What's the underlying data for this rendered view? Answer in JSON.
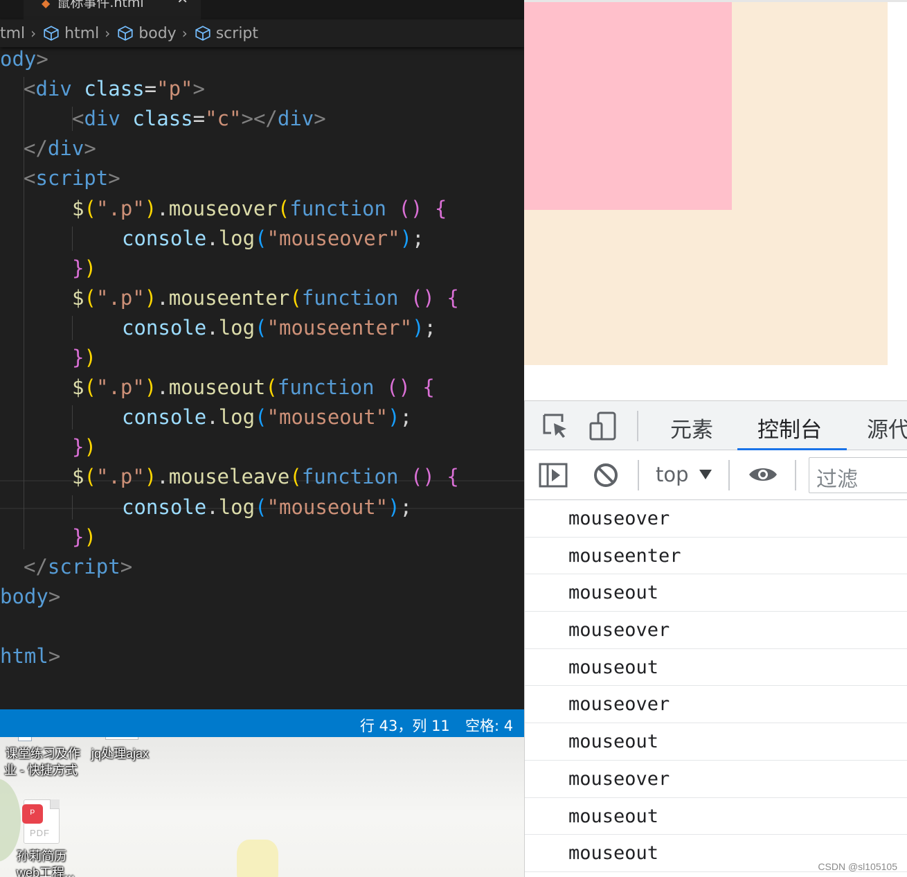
{
  "editor": {
    "tab": {
      "filename": "鼠标事件.html",
      "close_glyph": "✕"
    },
    "breadcrumb": {
      "items": [
        "tml",
        "html",
        "body",
        "script"
      ],
      "separator": "›"
    },
    "code_lines": [
      {
        "indent": 0,
        "tokens": [
          [
            "t-tag",
            "ody"
          ],
          [
            "t-punct",
            ">"
          ]
        ]
      },
      {
        "indent": 1,
        "tokens": [
          [
            "t-punct",
            "<"
          ],
          [
            "t-tag",
            "div"
          ],
          [
            "t-white",
            " "
          ],
          [
            "t-attr",
            "class"
          ],
          [
            "t-white",
            "="
          ],
          [
            "t-str",
            "\"p\""
          ],
          [
            "t-punct",
            ">"
          ]
        ]
      },
      {
        "indent": 2,
        "tokens": [
          [
            "t-punct",
            "<"
          ],
          [
            "t-tag",
            "div"
          ],
          [
            "t-white",
            " "
          ],
          [
            "t-attr",
            "class"
          ],
          [
            "t-white",
            "="
          ],
          [
            "t-str",
            "\"c\""
          ],
          [
            "t-punct",
            "></"
          ],
          [
            "t-tag",
            "div"
          ],
          [
            "t-punct",
            ">"
          ]
        ]
      },
      {
        "indent": 1,
        "tokens": [
          [
            "t-punct",
            "</"
          ],
          [
            "t-tag",
            "div"
          ],
          [
            "t-punct",
            ">"
          ]
        ]
      },
      {
        "indent": 1,
        "tokens": [
          [
            "t-punct",
            "<"
          ],
          [
            "t-tag",
            "script"
          ],
          [
            "t-punct",
            ">"
          ]
        ]
      },
      {
        "indent": 2,
        "tokens": [
          [
            "t-fn",
            "$"
          ],
          [
            "b1",
            "("
          ],
          [
            "t-str",
            "\".p\""
          ],
          [
            "b1",
            ")"
          ],
          [
            "t-white",
            "."
          ],
          [
            "t-fn",
            "mouseover"
          ],
          [
            "b1",
            "("
          ],
          [
            "t-kw",
            "function"
          ],
          [
            "t-white",
            " "
          ],
          [
            "b2",
            "()"
          ],
          [
            "t-white",
            " "
          ],
          [
            "b2",
            "{"
          ]
        ]
      },
      {
        "indent": 3,
        "tokens": [
          [
            "t-attr",
            "console"
          ],
          [
            "t-white",
            "."
          ],
          [
            "t-fn",
            "log"
          ],
          [
            "b3",
            "("
          ],
          [
            "t-str",
            "\"mouseover\""
          ],
          [
            "b3",
            ")"
          ],
          [
            "t-white",
            ";"
          ]
        ]
      },
      {
        "indent": 2,
        "tokens": [
          [
            "b2",
            "}"
          ],
          [
            "b1",
            ")"
          ]
        ]
      },
      {
        "indent": 2,
        "tokens": [
          [
            "t-fn",
            "$"
          ],
          [
            "b1",
            "("
          ],
          [
            "t-str",
            "\".p\""
          ],
          [
            "b1",
            ")"
          ],
          [
            "t-white",
            "."
          ],
          [
            "t-fn",
            "mouseenter"
          ],
          [
            "b1",
            "("
          ],
          [
            "t-kw",
            "function"
          ],
          [
            "t-white",
            " "
          ],
          [
            "b2",
            "()"
          ],
          [
            "t-white",
            " "
          ],
          [
            "b2",
            "{"
          ]
        ]
      },
      {
        "indent": 3,
        "tokens": [
          [
            "t-attr",
            "console"
          ],
          [
            "t-white",
            "."
          ],
          [
            "t-fn",
            "log"
          ],
          [
            "b3",
            "("
          ],
          [
            "t-str",
            "\"mouseenter\""
          ],
          [
            "b3",
            ")"
          ],
          [
            "t-white",
            ";"
          ]
        ]
      },
      {
        "indent": 2,
        "tokens": [
          [
            "b2",
            "}"
          ],
          [
            "b1",
            ")"
          ]
        ]
      },
      {
        "indent": 2,
        "tokens": [
          [
            "t-fn",
            "$"
          ],
          [
            "b1",
            "("
          ],
          [
            "t-str",
            "\".p\""
          ],
          [
            "b1",
            ")"
          ],
          [
            "t-white",
            "."
          ],
          [
            "t-fn",
            "mouseout"
          ],
          [
            "b1",
            "("
          ],
          [
            "t-kw",
            "function"
          ],
          [
            "t-white",
            " "
          ],
          [
            "b2",
            "()"
          ],
          [
            "t-white",
            " "
          ],
          [
            "b2",
            "{"
          ]
        ]
      },
      {
        "indent": 3,
        "tokens": [
          [
            "t-attr",
            "console"
          ],
          [
            "t-white",
            "."
          ],
          [
            "t-fn",
            "log"
          ],
          [
            "b3",
            "("
          ],
          [
            "t-str",
            "\"mouseout\""
          ],
          [
            "b3",
            ")"
          ],
          [
            "t-white",
            ";"
          ]
        ]
      },
      {
        "indent": 2,
        "tokens": [
          [
            "b2",
            "}"
          ],
          [
            "b1",
            ")"
          ]
        ]
      },
      {
        "indent": 2,
        "tokens": [
          [
            "t-fn",
            "$"
          ],
          [
            "b1",
            "("
          ],
          [
            "t-str",
            "\".p\""
          ],
          [
            "b1",
            ")"
          ],
          [
            "t-white",
            "."
          ],
          [
            "t-fn",
            "mouseleave"
          ],
          [
            "b1",
            "("
          ],
          [
            "t-kw",
            "function"
          ],
          [
            "t-white",
            " "
          ],
          [
            "b2",
            "()"
          ],
          [
            "t-white",
            " "
          ],
          [
            "b2",
            "{"
          ]
        ]
      },
      {
        "indent": 3,
        "tokens": [
          [
            "t-attr",
            "console"
          ],
          [
            "t-white",
            "."
          ],
          [
            "t-fn",
            "log"
          ],
          [
            "b3",
            "("
          ],
          [
            "t-str",
            "\"mouseout\""
          ],
          [
            "b3",
            ")"
          ],
          [
            "t-white",
            ";"
          ]
        ]
      },
      {
        "indent": 2,
        "tokens": [
          [
            "b2",
            "}"
          ],
          [
            "b1",
            ")"
          ]
        ]
      },
      {
        "indent": 1,
        "tokens": [
          [
            "t-punct",
            "</"
          ],
          [
            "t-tag",
            "script"
          ],
          [
            "t-punct",
            ">"
          ]
        ]
      },
      {
        "indent": 0,
        "tokens": [
          [
            "t-tag",
            "body"
          ],
          [
            "t-punct",
            ">"
          ]
        ]
      },
      {
        "indent": 0,
        "tokens": []
      },
      {
        "indent": 0,
        "tokens": [
          [
            "t-tag",
            "html"
          ],
          [
            "t-punct",
            ">"
          ]
        ]
      }
    ],
    "status": {
      "position": "行 43，列 11",
      "spaces": "空格: 4"
    }
  },
  "desktop": {
    "icons": [
      {
        "label_line1": "课堂练习及作",
        "label_line2": "业 - 快捷方式"
      },
      {
        "label_line1": "jq处理ajax",
        "label_line2": ""
      },
      {
        "label_line1": "孙莉简历",
        "label_line2": "web工程...",
        "file_type": "PDF"
      }
    ]
  },
  "page": {
    "outer_box_color": "#faebd7",
    "inner_box_color": "#ffc0cb"
  },
  "devtools": {
    "tabs": [
      "元素",
      "控制台",
      "源代"
    ],
    "active_tab": "控制台",
    "context": "top",
    "filter_placeholder": "过滤",
    "console_messages": [
      "mouseover",
      "mouseenter",
      "mouseout",
      "mouseover",
      "mouseout",
      "mouseover",
      "mouseout",
      "mouseover",
      "mouseout",
      "mouseout"
    ]
  },
  "watermark": "CSDN @sl105105"
}
